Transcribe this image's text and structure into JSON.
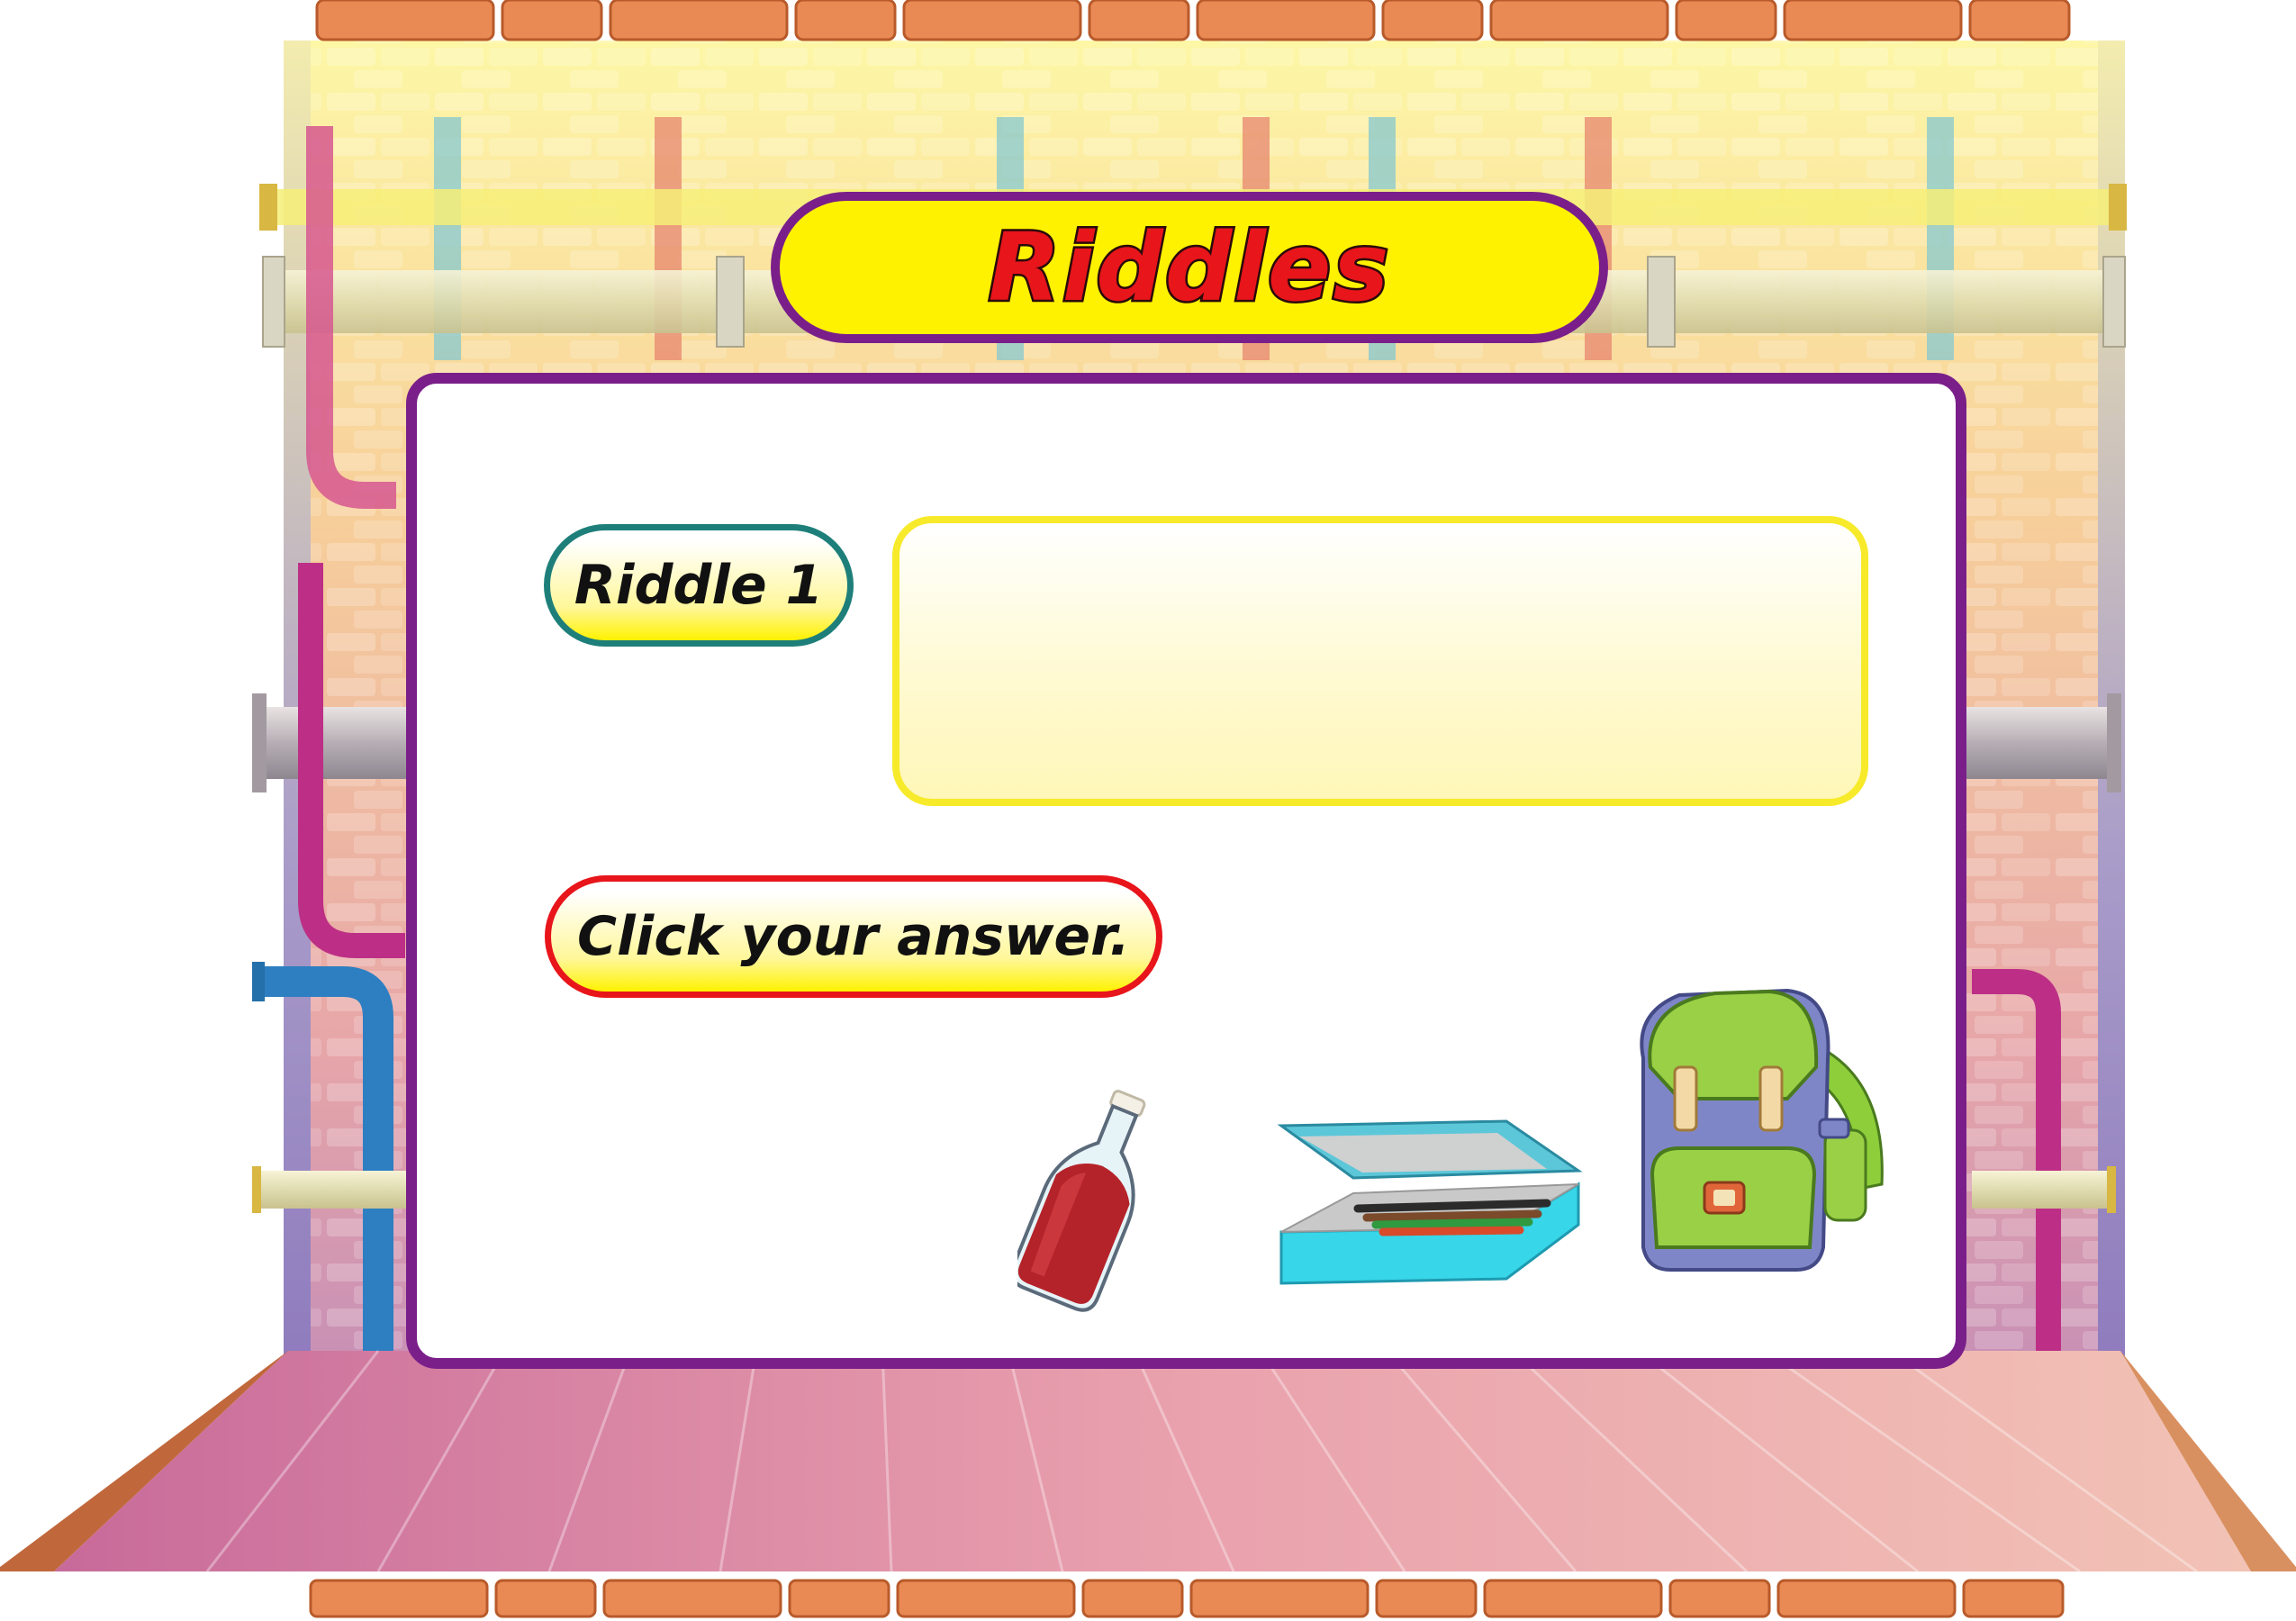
{
  "header": {
    "title": "Riddles"
  },
  "riddle": {
    "label": "Riddle 1",
    "question": ""
  },
  "instruction": {
    "label": "Click your answer."
  },
  "answers": [
    {
      "id": "bottle",
      "icon": "juice-bottle-icon"
    },
    {
      "id": "pencil-box",
      "icon": "pencil-box-icon"
    },
    {
      "id": "backpack",
      "icon": "backpack-icon"
    }
  ],
  "colors": {
    "title_text": "#e8151b",
    "title_banner": "#fff200",
    "panel_border": "#7a1f8a",
    "riddle_label_border": "#1e7f7a",
    "instruction_border": "#e8151b",
    "riddle_box_border": "#f7ea2a"
  }
}
